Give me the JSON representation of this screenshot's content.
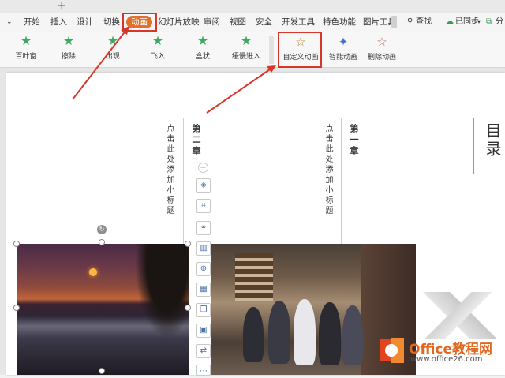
{
  "tabstrip": {
    "new_tab": "+"
  },
  "menu": {
    "items": [
      {
        "label": "开始"
      },
      {
        "label": "插入"
      },
      {
        "label": "设计"
      },
      {
        "label": "切换"
      },
      {
        "label": "动画"
      },
      {
        "label": "幻灯片放映"
      },
      {
        "label": "审阅"
      },
      {
        "label": "视图"
      },
      {
        "label": "安全"
      },
      {
        "label": "开发工具"
      },
      {
        "label": "特色功能"
      },
      {
        "label": "图片工具"
      }
    ],
    "active": "动画",
    "search_label": "查找",
    "sync_label": "已同步",
    "share_label": "分"
  },
  "animations": [
    {
      "label": "百叶窗",
      "icon": "star-icon"
    },
    {
      "label": "擦除",
      "icon": "star-icon"
    },
    {
      "label": "出现",
      "icon": "star-icon"
    },
    {
      "label": "飞入",
      "icon": "star-icon"
    },
    {
      "label": "盒状",
      "icon": "star-icon"
    },
    {
      "label": "缓慢进入",
      "icon": "star-icon"
    }
  ],
  "tools": {
    "custom": {
      "label": "自定义动画",
      "icon": "custom-animation-icon"
    },
    "smart": {
      "label": "智能动画",
      "icon": "smart-animation-icon"
    },
    "delete": {
      "label": "删除动画",
      "icon": "delete-animation-icon"
    }
  },
  "slide": {
    "toc_title": "目录",
    "chapter1": "第一章",
    "chapter2": "第二章",
    "placeholder1": "点击此处添加小标题",
    "placeholder2": "点击此处添加小标题"
  },
  "watermark": {
    "title": "Office教程网",
    "url": "www.office26.com"
  },
  "colors": {
    "accent": "#e26f2a",
    "highlight_red": "#d9362b",
    "star_green": "#3faa5f"
  }
}
